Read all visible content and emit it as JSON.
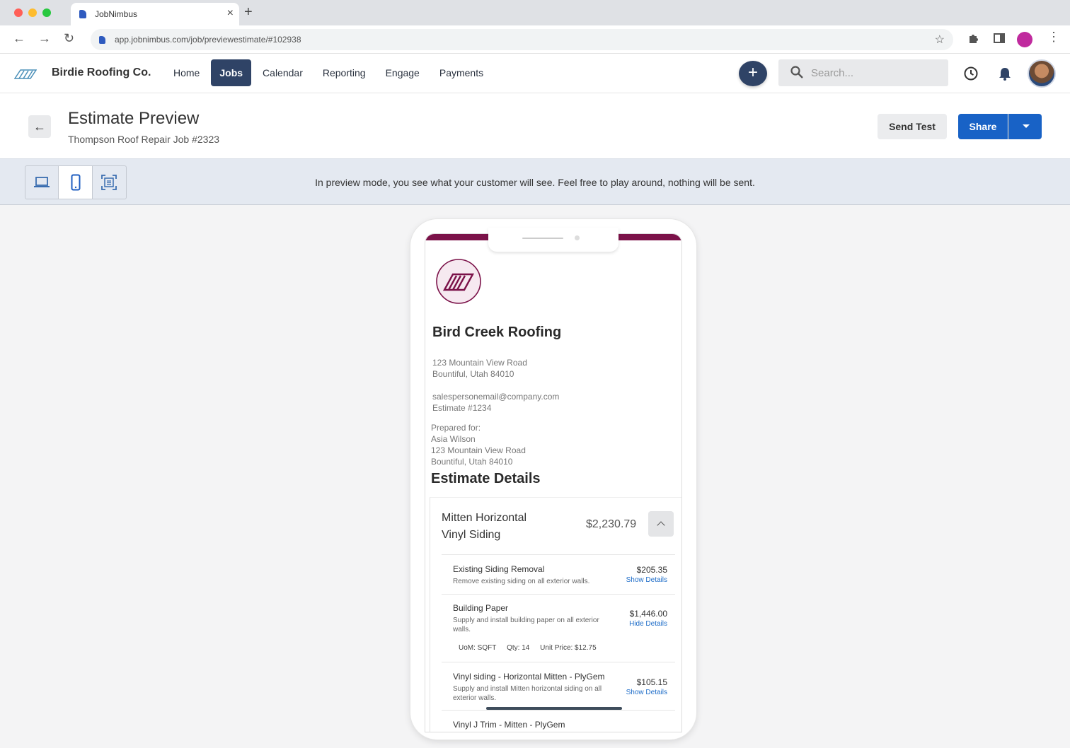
{
  "browser": {
    "tab_title": "JobNimbus",
    "url": "app.jobnimbus.com/job/previewestimate/#102938"
  },
  "app": {
    "brand": "Birdie Roofing Co.",
    "nav": [
      "Home",
      "Jobs",
      "Calendar",
      "Reporting",
      "Engage",
      "Payments"
    ],
    "active_nav": "Jobs",
    "search_placeholder": "Search...",
    "accent_color": "#2f4366",
    "primary_button_color": "#1862c6"
  },
  "page": {
    "title": "Estimate Preview",
    "subtitle": "Thompson Roof Repair Job #2323",
    "send_test_label": "Send Test",
    "share_label": "Share"
  },
  "preview": {
    "banner_text": "In preview mode, you see what your customer will see. Feel free to play around, nothing will be sent.",
    "device_modes": [
      "desktop-icon",
      "phone-icon",
      "fit-screen-icon"
    ],
    "active_mode": "phone-icon"
  },
  "estimate": {
    "brand_color": "#7b1249",
    "company_name": "Bird Creek Roofing",
    "company_address_1": "123 Mountain View Road",
    "company_address_2": "Bountiful, Utah 84010",
    "email": "salespersonemail@company.com",
    "estimate_number": "Estimate #1234",
    "prepared_for_label": "Prepared for:",
    "customer_name": "Asia Wilson",
    "customer_address_1": "123 Mountain View Road",
    "customer_address_2": "Bountiful, Utah 84010",
    "details_heading": "Estimate Details",
    "group": {
      "title": "Mitten Horizontal Vinyl Siding",
      "total": "$2,230.79"
    },
    "items": [
      {
        "name": "Existing Siding Removal",
        "description": "Remove existing siding on all exterior walls.",
        "price": "$205.35",
        "toggle": "Show Details"
      },
      {
        "name": "Building Paper",
        "description": "Supply and install building paper on all exterior walls.",
        "price": "$1,446.00",
        "toggle": "Hide Details",
        "uom": "UoM: SQFT",
        "qty": "Qty: 14",
        "unit_price": "Unit Price: $12.75"
      },
      {
        "name": "Vinyl siding - Horizontal Mitten - PlyGem",
        "description": "Supply and install Mitten horizontal siding on all exterior walls.",
        "price": "$105.15",
        "toggle": "Show Details"
      },
      {
        "name": "Vinyl J Trim - Mitten - PlyGem"
      }
    ]
  }
}
